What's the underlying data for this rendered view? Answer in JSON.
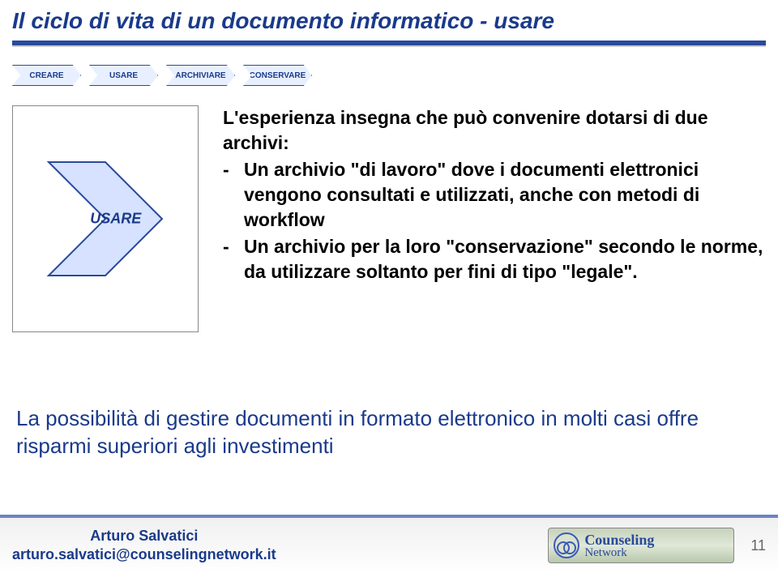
{
  "title": "Il ciclo di vita di un documento informatico - usare",
  "lifecycle": [
    "CREARE",
    "USARE",
    "ARCHIVIARE",
    "CONSERVARE"
  ],
  "arrow_label": "USARE",
  "intro": "L'esperienza insegna che può convenire dotarsi di due archivi:",
  "bullets": [
    "Un archivio \"di lavoro\" dove i documenti elettronici vengono consultati e utilizzati, anche con metodi di workflow",
    "Un archivio per la loro \"conservazione\" secondo le norme, da utilizzare soltanto per fini di tipo \"legale\"."
  ],
  "bottom": "La possibilità di gestire documenti in formato elettronico in molti casi offre risparmi superiori agli investimenti",
  "footer": {
    "author_name": "Arturo Salvatici",
    "author_email": "arturo.salvatici@counselingnetwork.it",
    "logo_line1": "Counseling",
    "logo_line2": "Network",
    "page": "11"
  }
}
